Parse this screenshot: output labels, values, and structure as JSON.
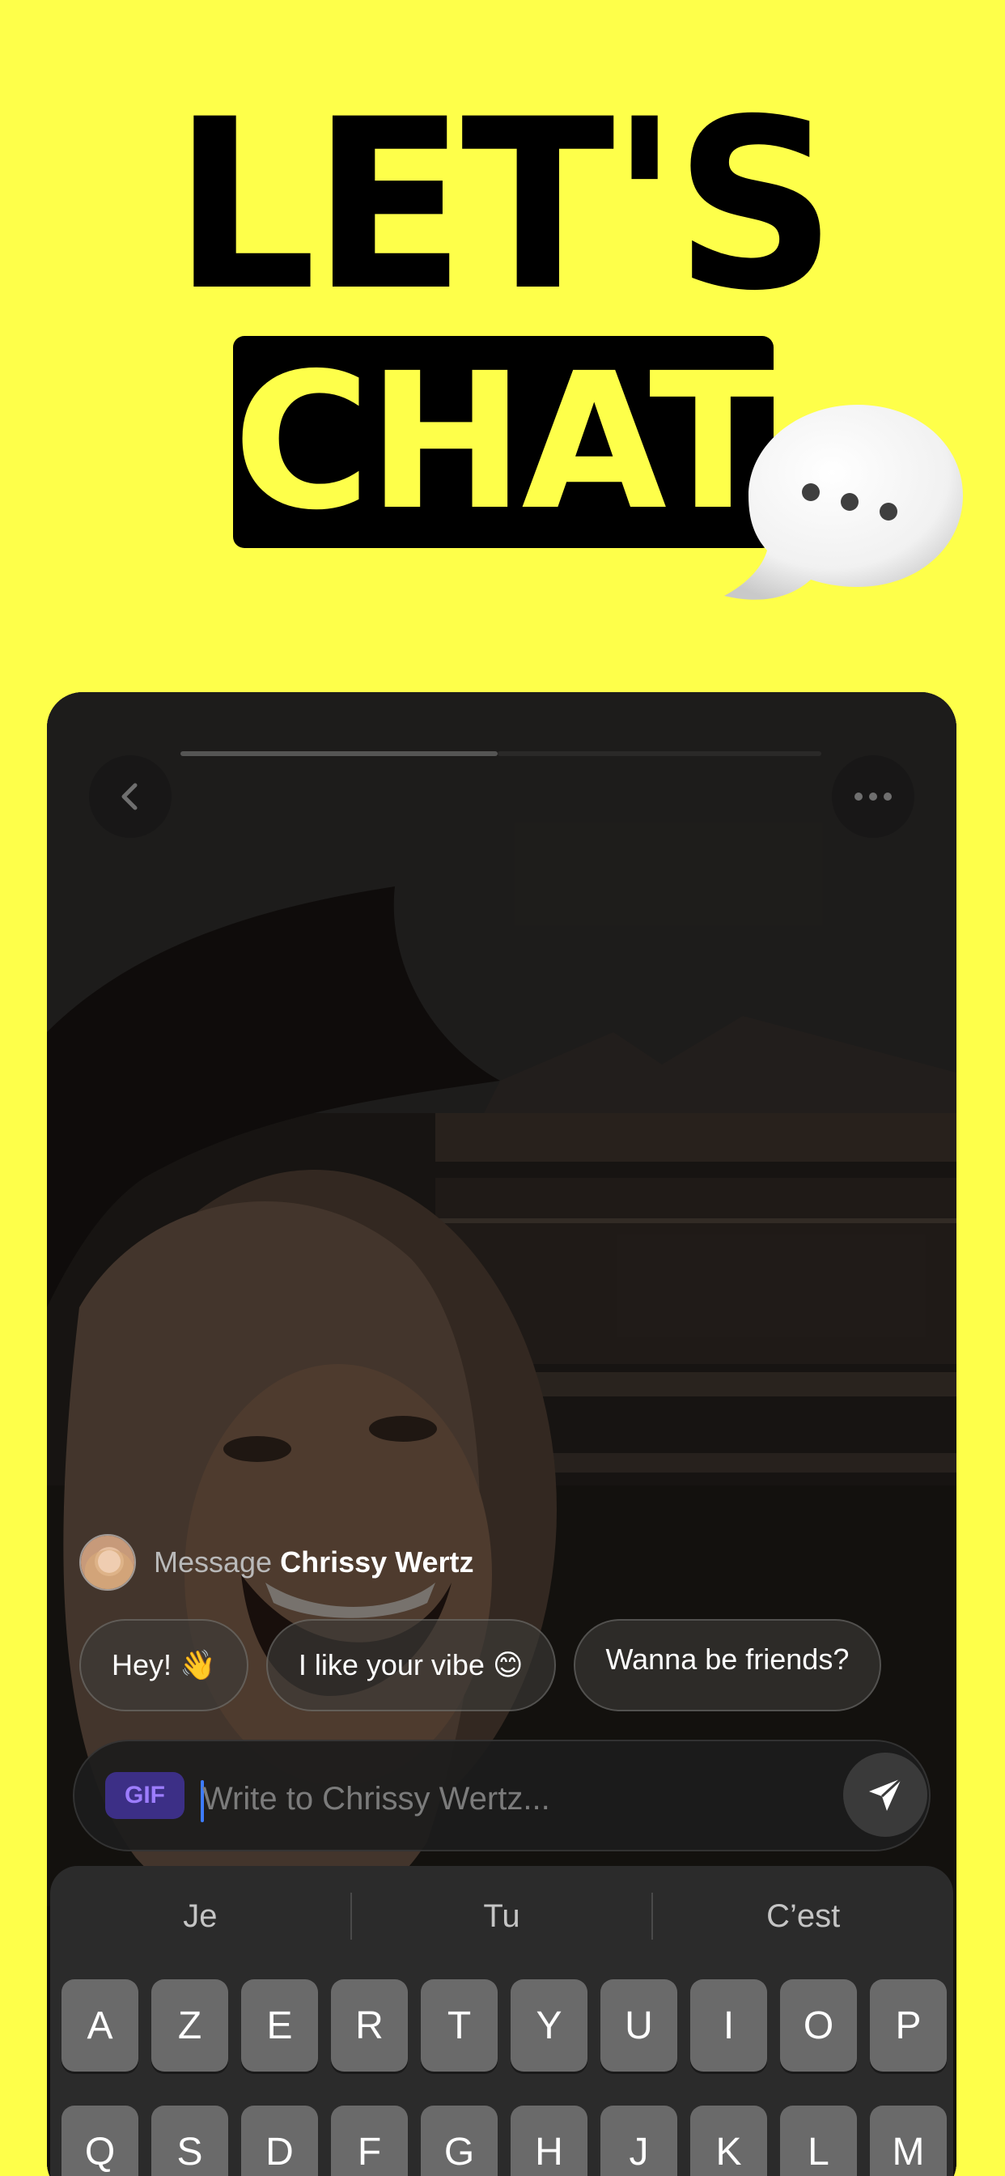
{
  "headline": {
    "line1": "LET'S",
    "line2": "CHAT"
  },
  "chat": {
    "message_prefix": "Message",
    "recipient_name": "Chrissy Wertz",
    "quick_replies": [
      {
        "label": "Hey! 👋"
      },
      {
        "label": "I like your vibe 😊"
      },
      {
        "label": "Wanna be friends?"
      }
    ],
    "gif_label": "GIF",
    "input_placeholder": "Write to Chrissy Wertz..."
  },
  "keyboard": {
    "suggestions": [
      "Je",
      "Tu",
      "C’est"
    ],
    "row1": [
      "A",
      "Z",
      "E",
      "R",
      "T",
      "Y",
      "U",
      "I",
      "O",
      "P"
    ],
    "row2": [
      "Q",
      "S",
      "D",
      "F",
      "G",
      "H",
      "J",
      "K",
      "L",
      "M"
    ]
  },
  "colors": {
    "background": "#FEFF4A",
    "headline": "#000000",
    "accent_blue": "#3D7BFF",
    "gif_badge": "#3C2F86"
  },
  "icons": [
    "speech-bubble-icon",
    "back-chevron-icon",
    "more-dots-icon",
    "send-icon"
  ]
}
